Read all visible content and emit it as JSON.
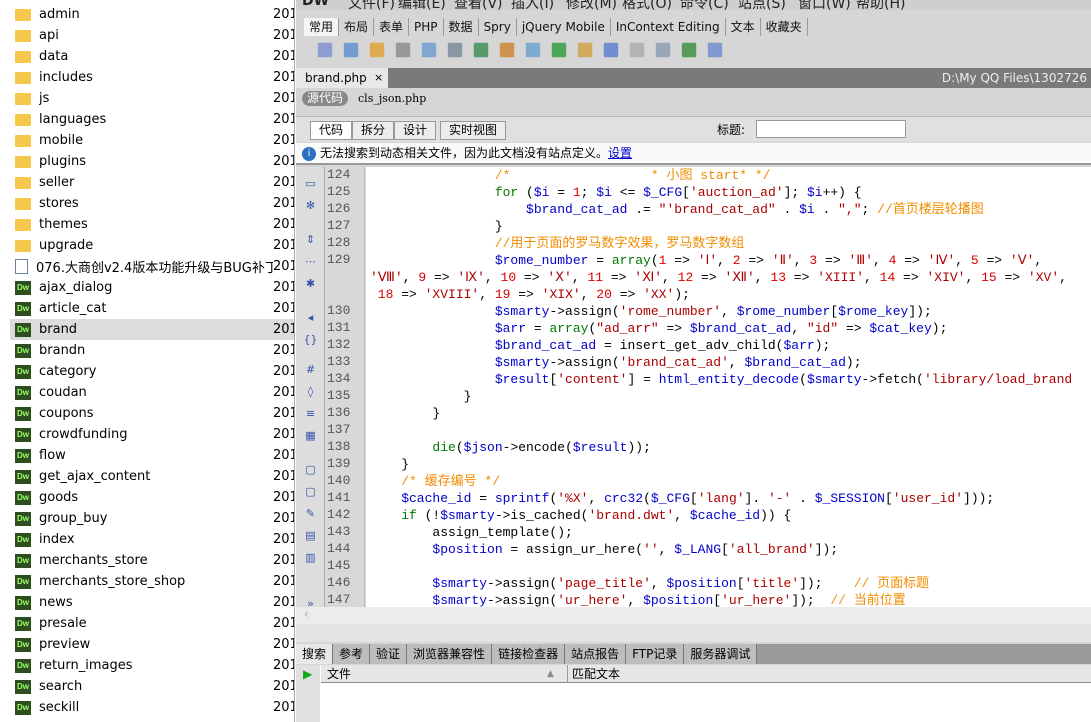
{
  "file_panel": {
    "items": [
      {
        "name": "admin",
        "type": "folder",
        "date": "201"
      },
      {
        "name": "api",
        "type": "folder",
        "date": "201"
      },
      {
        "name": "data",
        "type": "folder",
        "date": "201"
      },
      {
        "name": "includes",
        "type": "folder",
        "date": "201"
      },
      {
        "name": "js",
        "type": "folder",
        "date": "201"
      },
      {
        "name": "languages",
        "type": "folder",
        "date": "201"
      },
      {
        "name": "mobile",
        "type": "folder",
        "date": "201"
      },
      {
        "name": "plugins",
        "type": "folder",
        "date": "201"
      },
      {
        "name": "seller",
        "type": "folder",
        "date": "201"
      },
      {
        "name": "stores",
        "type": "folder",
        "date": "201"
      },
      {
        "name": "themes",
        "type": "folder",
        "date": "201"
      },
      {
        "name": "upgrade",
        "type": "folder",
        "date": "201"
      },
      {
        "name": "076.大商创v2.4版本功能升级与BUG补丁...",
        "type": "doc",
        "date": "201"
      },
      {
        "name": "ajax_dialog",
        "type": "dw",
        "date": "201"
      },
      {
        "name": "article_cat",
        "type": "dw",
        "date": "201"
      },
      {
        "name": "brand",
        "type": "dw",
        "date": "201",
        "selected": true
      },
      {
        "name": "brandn",
        "type": "dw",
        "date": "201"
      },
      {
        "name": "category",
        "type": "dw",
        "date": "201"
      },
      {
        "name": "coudan",
        "type": "dw",
        "date": "201"
      },
      {
        "name": "coupons",
        "type": "dw",
        "date": "201"
      },
      {
        "name": "crowdfunding",
        "type": "dw",
        "date": "201"
      },
      {
        "name": "flow",
        "type": "dw",
        "date": "201"
      },
      {
        "name": "get_ajax_content",
        "type": "dw",
        "date": "201"
      },
      {
        "name": "goods",
        "type": "dw",
        "date": "201"
      },
      {
        "name": "group_buy",
        "type": "dw",
        "date": "201"
      },
      {
        "name": "index",
        "type": "dw",
        "date": "201"
      },
      {
        "name": "merchants_store",
        "type": "dw",
        "date": "201"
      },
      {
        "name": "merchants_store_shop",
        "type": "dw",
        "date": "201"
      },
      {
        "name": "news",
        "type": "dw",
        "date": "201"
      },
      {
        "name": "presale",
        "type": "dw",
        "date": "201"
      },
      {
        "name": "preview",
        "type": "dw",
        "date": "201"
      },
      {
        "name": "return_images",
        "type": "dw",
        "date": "201"
      },
      {
        "name": "search",
        "type": "dw",
        "date": "201"
      },
      {
        "name": "seckill",
        "type": "dw",
        "date": "201"
      }
    ],
    "dw_icon_label": "Dw"
  },
  "menu": [
    "DW",
    "文件(F)",
    "编辑(E)",
    "查看(V)",
    "插入(I)",
    "修改(M)",
    "格式(O)",
    "命令(C)",
    "站点(S)",
    "窗口(W)",
    "帮助(H)"
  ],
  "insert_tabs": [
    "常用",
    "布局",
    "表单",
    "PHP",
    "数据",
    "Spry",
    "jQuery Mobile",
    "InContext Editing",
    "文本",
    "收藏夹"
  ],
  "document": {
    "tab": "brand.php",
    "close": "×",
    "path": "D:\\My QQ Files\\1302726",
    "source_label": "源代码",
    "related_file": "cls_json.php",
    "view_buttons": [
      "代码",
      "拆分",
      "设计",
      "实时视图"
    ],
    "title_label": "标题:",
    "title_value": "",
    "info_text": "无法搜索到动态相关文件，因为此文档没有站点定义。",
    "info_link": "设置"
  },
  "code": [
    {
      "n": "124",
      "t": [
        [
          "c",
          "                /*                  * 小图 start* */"
        ]
      ]
    },
    {
      "n": "125",
      "t": [
        [
          "k",
          "                for"
        ],
        [
          "f",
          " ("
        ],
        [
          "v",
          "$i"
        ],
        [
          "f",
          " = "
        ],
        [
          "n",
          "1"
        ],
        [
          "f",
          "; "
        ],
        [
          "v",
          "$i"
        ],
        [
          "f",
          " <= "
        ],
        [
          "v",
          "$_CFG"
        ],
        [
          "f",
          "["
        ],
        [
          "s",
          "'auction_ad'"
        ],
        [
          "f",
          "]; "
        ],
        [
          "v",
          "$i"
        ],
        [
          "f",
          "++) {"
        ]
      ]
    },
    {
      "n": "126",
      "t": [
        [
          "v",
          "                    $brand_cat_ad"
        ],
        [
          "f",
          " .= "
        ],
        [
          "s",
          "\"'brand_cat_ad\""
        ],
        [
          "f",
          " . "
        ],
        [
          "v",
          "$i"
        ],
        [
          "f",
          " . "
        ],
        [
          "s",
          "\",\""
        ],
        [
          "f",
          "; "
        ],
        [
          "c",
          "//首页楼层轮播图"
        ]
      ]
    },
    {
      "n": "127",
      "t": [
        [
          "f",
          "                }"
        ]
      ]
    },
    {
      "n": "128",
      "t": [
        [
          "c",
          "                //用于页面的罗马数字效果，罗马数字数组"
        ]
      ]
    },
    {
      "n": "129",
      "t": [
        [
          "v",
          "                $rome_number"
        ],
        [
          "f",
          " = "
        ],
        [
          "k",
          "array"
        ],
        [
          "f",
          "("
        ],
        [
          "n",
          "1"
        ],
        [
          "f",
          " => "
        ],
        [
          "s",
          "'Ⅰ'"
        ],
        [
          "f",
          ", "
        ],
        [
          "n",
          "2"
        ],
        [
          "f",
          " => "
        ],
        [
          "s",
          "'Ⅱ'"
        ],
        [
          "f",
          ", "
        ],
        [
          "n",
          "3"
        ],
        [
          "f",
          " => "
        ],
        [
          "s",
          "'Ⅲ'"
        ],
        [
          "f",
          ", "
        ],
        [
          "n",
          "4"
        ],
        [
          "f",
          " => "
        ],
        [
          "s",
          "'Ⅳ'"
        ],
        [
          "f",
          ", "
        ],
        [
          "n",
          "5"
        ],
        [
          "f",
          " => "
        ],
        [
          "s",
          "'Ⅴ'"
        ],
        [
          "f",
          ","
        ]
      ]
    },
    {
      "n": "",
      "t": [
        [
          "s",
          "'Ⅷ'"
        ],
        [
          "f",
          ", "
        ],
        [
          "n",
          "9"
        ],
        [
          "f",
          " => "
        ],
        [
          "s",
          "'Ⅸ'"
        ],
        [
          "f",
          ", "
        ],
        [
          "n",
          "10"
        ],
        [
          "f",
          " => "
        ],
        [
          "s",
          "'Ⅹ'"
        ],
        [
          "f",
          ", "
        ],
        [
          "n",
          "11"
        ],
        [
          "f",
          " => "
        ],
        [
          "s",
          "'Ⅺ'"
        ],
        [
          "f",
          ", "
        ],
        [
          "n",
          "12"
        ],
        [
          "f",
          " => "
        ],
        [
          "s",
          "'Ⅻ'"
        ],
        [
          "f",
          ", "
        ],
        [
          "n",
          "13"
        ],
        [
          "f",
          " => "
        ],
        [
          "s",
          "'XIII'"
        ],
        [
          "f",
          ", "
        ],
        [
          "n",
          "14"
        ],
        [
          "f",
          " => "
        ],
        [
          "s",
          "'XIV'"
        ],
        [
          "f",
          ", "
        ],
        [
          "n",
          "15"
        ],
        [
          "f",
          " => "
        ],
        [
          "s",
          "'XV'"
        ],
        [
          "f",
          ","
        ]
      ]
    },
    {
      "n": "",
      "t": [
        [
          "n",
          " 18"
        ],
        [
          "f",
          " => "
        ],
        [
          "s",
          "'XVIII'"
        ],
        [
          "f",
          ", "
        ],
        [
          "n",
          "19"
        ],
        [
          "f",
          " => "
        ],
        [
          "s",
          "'XIX'"
        ],
        [
          "f",
          ", "
        ],
        [
          "n",
          "20"
        ],
        [
          "f",
          " => "
        ],
        [
          "s",
          "'XX'"
        ],
        [
          "f",
          ");"
        ]
      ]
    },
    {
      "n": "130",
      "t": [
        [
          "v",
          "                $smarty"
        ],
        [
          "f",
          "->assign("
        ],
        [
          "s",
          "'rome_number'"
        ],
        [
          "f",
          ", "
        ],
        [
          "v",
          "$rome_number"
        ],
        [
          "f",
          "["
        ],
        [
          "v",
          "$rome_key"
        ],
        [
          "f",
          "]);"
        ]
      ]
    },
    {
      "n": "131",
      "t": [
        [
          "v",
          "                $arr"
        ],
        [
          "f",
          " = "
        ],
        [
          "k",
          "array"
        ],
        [
          "f",
          "("
        ],
        [
          "s",
          "\"ad_arr\""
        ],
        [
          "f",
          " => "
        ],
        [
          "v",
          "$brand_cat_ad"
        ],
        [
          "f",
          ", "
        ],
        [
          "s",
          "\"id\""
        ],
        [
          "f",
          " => "
        ],
        [
          "v",
          "$cat_key"
        ],
        [
          "f",
          ");"
        ]
      ]
    },
    {
      "n": "132",
      "t": [
        [
          "v",
          "                $brand_cat_ad"
        ],
        [
          "f",
          " = insert_get_adv_child("
        ],
        [
          "v",
          "$arr"
        ],
        [
          "f",
          ");"
        ]
      ]
    },
    {
      "n": "133",
      "t": [
        [
          "v",
          "                $smarty"
        ],
        [
          "f",
          "->assign("
        ],
        [
          "s",
          "'brand_cat_ad'"
        ],
        [
          "f",
          ", "
        ],
        [
          "v",
          "$brand_cat_ad"
        ],
        [
          "f",
          ");"
        ]
      ]
    },
    {
      "n": "134",
      "t": [
        [
          "v",
          "                $result"
        ],
        [
          "f",
          "["
        ],
        [
          "s",
          "'content'"
        ],
        [
          "f",
          "] = "
        ],
        [
          "p",
          "html_entity_decode"
        ],
        [
          "f",
          "("
        ],
        [
          "v",
          "$smarty"
        ],
        [
          "f",
          "->fetch("
        ],
        [
          "s",
          "'library/load_brand"
        ]
      ]
    },
    {
      "n": "135",
      "t": [
        [
          "f",
          "            }"
        ]
      ]
    },
    {
      "n": "136",
      "t": [
        [
          "f",
          "        }"
        ]
      ]
    },
    {
      "n": "137",
      "t": []
    },
    {
      "n": "138",
      "t": [
        [
          "k",
          "        die"
        ],
        [
          "f",
          "("
        ],
        [
          "v",
          "$json"
        ],
        [
          "f",
          "->encode("
        ],
        [
          "v",
          "$result"
        ],
        [
          "f",
          "));"
        ]
      ]
    },
    {
      "n": "139",
      "t": [
        [
          "f",
          "    }"
        ]
      ]
    },
    {
      "n": "140",
      "t": [
        [
          "c",
          "    /* 缓存编号 */"
        ]
      ]
    },
    {
      "n": "141",
      "t": [
        [
          "v",
          "    $cache_id"
        ],
        [
          "f",
          " = "
        ],
        [
          "p",
          "sprintf"
        ],
        [
          "f",
          "("
        ],
        [
          "s",
          "'%X'"
        ],
        [
          "f",
          ", "
        ],
        [
          "p",
          "crc32"
        ],
        [
          "f",
          "("
        ],
        [
          "v",
          "$_CFG"
        ],
        [
          "f",
          "["
        ],
        [
          "s",
          "'lang'"
        ],
        [
          "f",
          "]. "
        ],
        [
          "s",
          "'-'"
        ],
        [
          "f",
          " . "
        ],
        [
          "v",
          "$_SESSION"
        ],
        [
          "f",
          "["
        ],
        [
          "s",
          "'user_id'"
        ],
        [
          "f",
          "]));"
        ]
      ]
    },
    {
      "n": "142",
      "t": [
        [
          "k",
          "    if"
        ],
        [
          "f",
          " (!"
        ],
        [
          "v",
          "$smarty"
        ],
        [
          "f",
          "->is_cached("
        ],
        [
          "s",
          "'brand.dwt'"
        ],
        [
          "f",
          ", "
        ],
        [
          "v",
          "$cache_id"
        ],
        [
          "f",
          ")) {"
        ]
      ]
    },
    {
      "n": "143",
      "t": [
        [
          "f",
          "        assign_template();"
        ]
      ]
    },
    {
      "n": "144",
      "t": [
        [
          "v",
          "        $position"
        ],
        [
          "f",
          " = assign_ur_here("
        ],
        [
          "s",
          "''"
        ],
        [
          "f",
          ", "
        ],
        [
          "v",
          "$_LANG"
        ],
        [
          "f",
          "["
        ],
        [
          "s",
          "'all_brand'"
        ],
        [
          "f",
          "]);"
        ]
      ]
    },
    {
      "n": "145",
      "t": []
    },
    {
      "n": "146",
      "t": [
        [
          "v",
          "        $smarty"
        ],
        [
          "f",
          "->assign("
        ],
        [
          "s",
          "'page_title'"
        ],
        [
          "f",
          ", "
        ],
        [
          "v",
          "$position"
        ],
        [
          "f",
          "["
        ],
        [
          "s",
          "'title'"
        ],
        [
          "f",
          "]);    "
        ],
        [
          "c",
          "// 页面标题"
        ]
      ]
    },
    {
      "n": "147",
      "t": [
        [
          "v",
          "        $smarty"
        ],
        [
          "f",
          "->assign("
        ],
        [
          "s",
          "'ur_here'"
        ],
        [
          "f",
          ", "
        ],
        [
          "v",
          "$position"
        ],
        [
          "f",
          "["
        ],
        [
          "s",
          "'ur_here'"
        ],
        [
          "f",
          "]);  "
        ],
        [
          "c",
          "// 当前位置"
        ]
      ]
    }
  ],
  "bottom_panel": {
    "tabs": [
      "搜索",
      "参考",
      "验证",
      "浏览器兼容性",
      "链接检查器",
      "站点报告",
      "FTP记录",
      "服务器调试"
    ],
    "columns": [
      "文件",
      "匹配文本"
    ]
  }
}
